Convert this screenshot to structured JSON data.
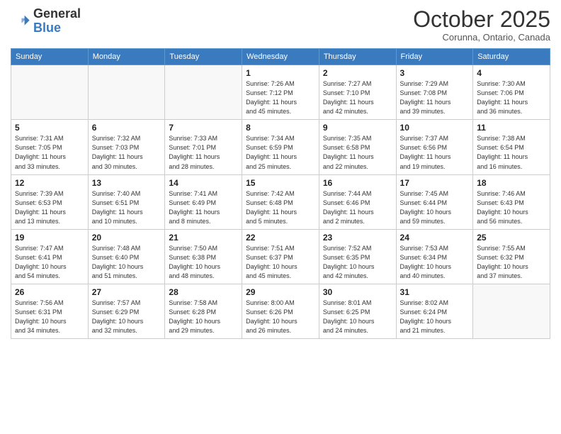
{
  "header": {
    "logo_general": "General",
    "logo_blue": "Blue",
    "month_title": "October 2025",
    "subtitle": "Corunna, Ontario, Canada"
  },
  "days_of_week": [
    "Sunday",
    "Monday",
    "Tuesday",
    "Wednesday",
    "Thursday",
    "Friday",
    "Saturday"
  ],
  "weeks": [
    [
      {
        "day": "",
        "info": ""
      },
      {
        "day": "",
        "info": ""
      },
      {
        "day": "",
        "info": ""
      },
      {
        "day": "1",
        "info": "Sunrise: 7:26 AM\nSunset: 7:12 PM\nDaylight: 11 hours\nand 45 minutes."
      },
      {
        "day": "2",
        "info": "Sunrise: 7:27 AM\nSunset: 7:10 PM\nDaylight: 11 hours\nand 42 minutes."
      },
      {
        "day": "3",
        "info": "Sunrise: 7:29 AM\nSunset: 7:08 PM\nDaylight: 11 hours\nand 39 minutes."
      },
      {
        "day": "4",
        "info": "Sunrise: 7:30 AM\nSunset: 7:06 PM\nDaylight: 11 hours\nand 36 minutes."
      }
    ],
    [
      {
        "day": "5",
        "info": "Sunrise: 7:31 AM\nSunset: 7:05 PM\nDaylight: 11 hours\nand 33 minutes."
      },
      {
        "day": "6",
        "info": "Sunrise: 7:32 AM\nSunset: 7:03 PM\nDaylight: 11 hours\nand 30 minutes."
      },
      {
        "day": "7",
        "info": "Sunrise: 7:33 AM\nSunset: 7:01 PM\nDaylight: 11 hours\nand 28 minutes."
      },
      {
        "day": "8",
        "info": "Sunrise: 7:34 AM\nSunset: 6:59 PM\nDaylight: 11 hours\nand 25 minutes."
      },
      {
        "day": "9",
        "info": "Sunrise: 7:35 AM\nSunset: 6:58 PM\nDaylight: 11 hours\nand 22 minutes."
      },
      {
        "day": "10",
        "info": "Sunrise: 7:37 AM\nSunset: 6:56 PM\nDaylight: 11 hours\nand 19 minutes."
      },
      {
        "day": "11",
        "info": "Sunrise: 7:38 AM\nSunset: 6:54 PM\nDaylight: 11 hours\nand 16 minutes."
      }
    ],
    [
      {
        "day": "12",
        "info": "Sunrise: 7:39 AM\nSunset: 6:53 PM\nDaylight: 11 hours\nand 13 minutes."
      },
      {
        "day": "13",
        "info": "Sunrise: 7:40 AM\nSunset: 6:51 PM\nDaylight: 11 hours\nand 10 minutes."
      },
      {
        "day": "14",
        "info": "Sunrise: 7:41 AM\nSunset: 6:49 PM\nDaylight: 11 hours\nand 8 minutes."
      },
      {
        "day": "15",
        "info": "Sunrise: 7:42 AM\nSunset: 6:48 PM\nDaylight: 11 hours\nand 5 minutes."
      },
      {
        "day": "16",
        "info": "Sunrise: 7:44 AM\nSunset: 6:46 PM\nDaylight: 11 hours\nand 2 minutes."
      },
      {
        "day": "17",
        "info": "Sunrise: 7:45 AM\nSunset: 6:44 PM\nDaylight: 10 hours\nand 59 minutes."
      },
      {
        "day": "18",
        "info": "Sunrise: 7:46 AM\nSunset: 6:43 PM\nDaylight: 10 hours\nand 56 minutes."
      }
    ],
    [
      {
        "day": "19",
        "info": "Sunrise: 7:47 AM\nSunset: 6:41 PM\nDaylight: 10 hours\nand 54 minutes."
      },
      {
        "day": "20",
        "info": "Sunrise: 7:48 AM\nSunset: 6:40 PM\nDaylight: 10 hours\nand 51 minutes."
      },
      {
        "day": "21",
        "info": "Sunrise: 7:50 AM\nSunset: 6:38 PM\nDaylight: 10 hours\nand 48 minutes."
      },
      {
        "day": "22",
        "info": "Sunrise: 7:51 AM\nSunset: 6:37 PM\nDaylight: 10 hours\nand 45 minutes."
      },
      {
        "day": "23",
        "info": "Sunrise: 7:52 AM\nSunset: 6:35 PM\nDaylight: 10 hours\nand 42 minutes."
      },
      {
        "day": "24",
        "info": "Sunrise: 7:53 AM\nSunset: 6:34 PM\nDaylight: 10 hours\nand 40 minutes."
      },
      {
        "day": "25",
        "info": "Sunrise: 7:55 AM\nSunset: 6:32 PM\nDaylight: 10 hours\nand 37 minutes."
      }
    ],
    [
      {
        "day": "26",
        "info": "Sunrise: 7:56 AM\nSunset: 6:31 PM\nDaylight: 10 hours\nand 34 minutes."
      },
      {
        "day": "27",
        "info": "Sunrise: 7:57 AM\nSunset: 6:29 PM\nDaylight: 10 hours\nand 32 minutes."
      },
      {
        "day": "28",
        "info": "Sunrise: 7:58 AM\nSunset: 6:28 PM\nDaylight: 10 hours\nand 29 minutes."
      },
      {
        "day": "29",
        "info": "Sunrise: 8:00 AM\nSunset: 6:26 PM\nDaylight: 10 hours\nand 26 minutes."
      },
      {
        "day": "30",
        "info": "Sunrise: 8:01 AM\nSunset: 6:25 PM\nDaylight: 10 hours\nand 24 minutes."
      },
      {
        "day": "31",
        "info": "Sunrise: 8:02 AM\nSunset: 6:24 PM\nDaylight: 10 hours\nand 21 minutes."
      },
      {
        "day": "",
        "info": ""
      }
    ]
  ]
}
